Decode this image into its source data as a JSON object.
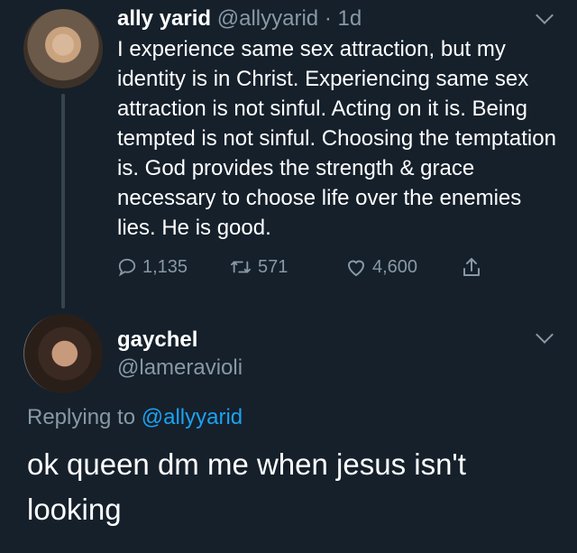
{
  "tweet1": {
    "display_name": "ally yarid",
    "handle": "@allyyarid",
    "time": "· 1d",
    "text": "I experience same sex attraction, but my identity is in Christ. Experiencing same sex attraction is not sinful. Acting on it is. Being tempted is not sinful. Choosing the temptation is. God provides the strength & grace necessary to choose life over the enemies lies. He is good.",
    "replies": "1,135",
    "retweets": "571",
    "likes": "4,600",
    "icons": {
      "reply": "reply-icon",
      "retweet": "retweet-icon",
      "like": "heart-icon",
      "share": "share-icon",
      "menu": "chevron-down-icon"
    }
  },
  "tweet2": {
    "display_name": "gaychel",
    "handle": "@lameravioli",
    "replying_prefix": "Replying to",
    "replying_handle": "@allyyarid",
    "text": "ok queen dm me when jesus isn't looking",
    "icons": {
      "menu": "chevron-down-icon"
    }
  },
  "colors": {
    "background": "#15202b",
    "muted": "#8899a6",
    "link": "#1da1f2",
    "thread_line": "#38444d"
  }
}
